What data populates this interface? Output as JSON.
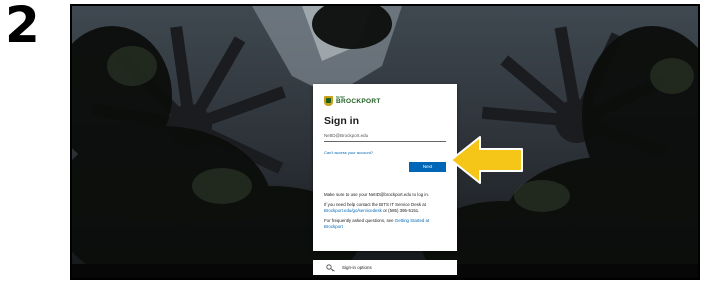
{
  "step": {
    "number": "2"
  },
  "logo": {
    "suny": "SUNY",
    "name": "BROCKPORT"
  },
  "signin": {
    "title": "Sign in",
    "username_value": "NetID@Brockport.edu",
    "cant_access": "Can't access your account?",
    "next_label": "Next"
  },
  "info": {
    "p1": "Make sure to use your NetID@brockport.edu to log in.",
    "p2_prefix": "If you need help contact the BITS IT Service Desk at",
    "p2_link": "Brockport.edu/go/servicedesk",
    "p2_suffix": " or (585) 395-5151.",
    "p3_prefix": "For frequently asked questions, see",
    "p3_link": "Getting Started at Brockport"
  },
  "options": {
    "label": "Sign-in options",
    "icon": "key-icon"
  },
  "colors": {
    "accent": "#0067b8",
    "arrow": "#f5c518",
    "brand": "#1b5e20"
  }
}
